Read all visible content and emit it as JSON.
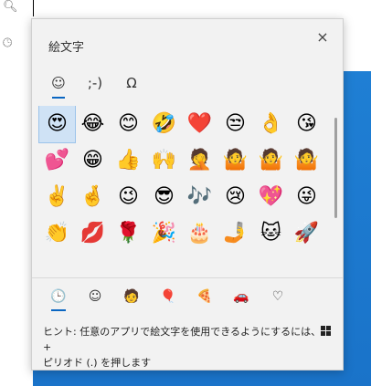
{
  "panel": {
    "title": "絵文字",
    "close_icon": "×"
  },
  "tabs": [
    {
      "label": "☺",
      "name": "emoji-tab",
      "active": true
    },
    {
      "label": ";-)",
      "name": "kaomoji-tab",
      "active": false
    },
    {
      "label": "Ω",
      "name": "symbols-tab",
      "active": false
    }
  ],
  "emojis": [
    "😍",
    "😂",
    "😊",
    "🤣",
    "❤️",
    "😒",
    "👌",
    "😘",
    "💕",
    "😁",
    "👍",
    "🙌",
    "🤦",
    "🤷",
    "🤷",
    "🤷",
    "✌️",
    "🤞",
    "😉",
    "😎",
    "🎶",
    "😢",
    "💖",
    "😜",
    "👏",
    "💋",
    "🌹",
    "🎉",
    "🎂",
    "🤳",
    "🐱",
    "🚀"
  ],
  "categories": [
    {
      "label": "🕒",
      "name": "recent-icon",
      "active": true
    },
    {
      "label": "☺",
      "name": "smiley-icon",
      "active": false
    },
    {
      "label": "🧑",
      "name": "people-icon",
      "active": false
    },
    {
      "label": "🎈",
      "name": "celebration-icon",
      "active": false
    },
    {
      "label": "🍕",
      "name": "food-icon",
      "active": false
    },
    {
      "label": "🚗",
      "name": "transport-icon",
      "active": false
    },
    {
      "label": "♡",
      "name": "heart-icon",
      "active": false
    }
  ],
  "hint": {
    "line1_before": "ヒント: 任意のアプリで絵文字を使用できるようにするには、",
    "line1_after": " +",
    "line2": "ピリオド (.) を押します"
  }
}
